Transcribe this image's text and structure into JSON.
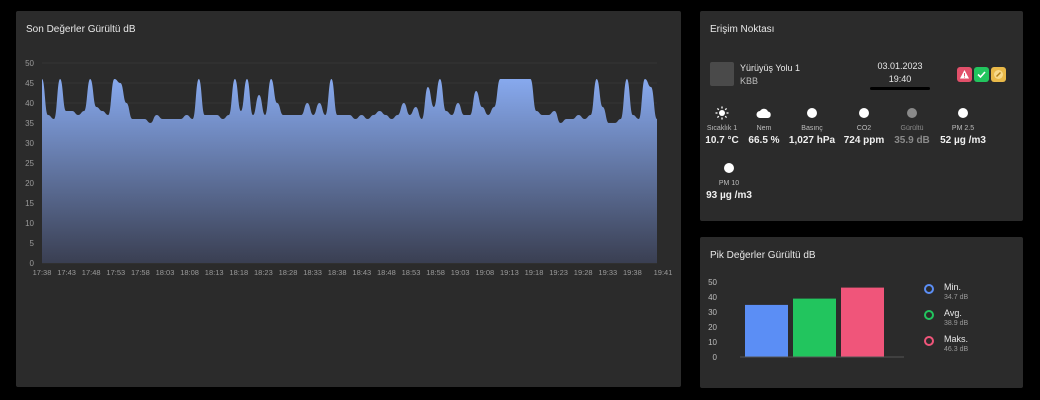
{
  "noise_panel": {
    "title": "Son Değerler Gürültü dB"
  },
  "access_point": {
    "title": "Erişim Noktası",
    "station_name": "Yürüyüş Yolu 1",
    "station_sub": "KBB",
    "date": "03.01.2023",
    "time": "19:40",
    "badges": [
      {
        "icon": "warning-icon",
        "color": "#e2506a"
      },
      {
        "icon": "check-icon",
        "color": "#22c55e"
      },
      {
        "icon": "edit-icon",
        "color": "#e9b949"
      }
    ],
    "metrics": [
      {
        "name": "temperature",
        "icon": "sun-icon",
        "label": "Sıcaklık 1",
        "value": "10.7 °C"
      },
      {
        "name": "humidity",
        "icon": "cloud-icon",
        "label": "Nem",
        "value": "66.5 %"
      },
      {
        "name": "pressure",
        "icon": "dot-icon",
        "label": "Basınç",
        "value": "1,027 hPa"
      },
      {
        "name": "co2",
        "icon": "dot-icon",
        "label": "CO2",
        "value": "724 ppm"
      },
      {
        "name": "noise",
        "icon": "dot-icon",
        "label": "Gürültü",
        "value": "35.9 dB",
        "dim": true
      },
      {
        "name": "pm25",
        "icon": "dot-icon",
        "label": "PM 2.5",
        "value": "52 µg /m3"
      },
      {
        "name": "pm10",
        "icon": "dot-icon",
        "label": "PM 10",
        "value": "93 µg /m3"
      }
    ]
  },
  "peak_panel": {
    "title": "Pik Değerler Gürültü dB",
    "legend": [
      {
        "name": "Min.",
        "value": "34.7 dB",
        "color": "#5b8ef5"
      },
      {
        "name": "Avg.",
        "value": "38.9 dB",
        "color": "#22c55e"
      },
      {
        "name": "Maks.",
        "value": "46.3 dB",
        "color": "#f0557a"
      }
    ]
  },
  "chart_data": [
    {
      "type": "area",
      "title": "Son Değerler Gürültü dB",
      "ylim": [
        0,
        50
      ],
      "yticks": [
        0,
        5,
        10,
        15,
        20,
        25,
        30,
        35,
        40,
        45,
        50
      ],
      "x_labels": [
        "17:38",
        "17:43",
        "17:48",
        "17:53",
        "17:58",
        "18:03",
        "18:08",
        "18:13",
        "18:18",
        "18:23",
        "18:28",
        "18:33",
        "18:38",
        "18:43",
        "18:48",
        "18:53",
        "18:58",
        "19:03",
        "19:08",
        "19:13",
        "19:18",
        "19:23",
        "19:28",
        "19:33",
        "19:38",
        "19:41"
      ],
      "color": "#7a9ee6",
      "values": [
        46,
        37,
        36,
        46,
        38,
        38,
        37,
        38,
        46,
        39,
        38,
        37,
        46,
        45,
        40,
        36,
        36,
        36,
        35,
        37,
        36,
        36,
        36,
        36,
        37,
        36,
        46,
        37,
        37,
        37,
        36,
        37,
        46,
        38,
        46,
        37,
        42,
        37,
        46,
        40,
        37,
        37,
        37,
        37,
        40,
        37,
        40,
        37,
        46,
        37,
        37,
        37,
        36,
        37,
        36,
        37,
        38,
        37,
        36,
        37,
        40,
        37,
        39,
        36,
        44,
        39,
        46,
        38,
        37,
        40,
        37,
        37,
        43,
        39,
        37,
        39,
        46,
        46,
        46,
        46,
        46,
        46,
        38,
        37,
        37,
        38,
        35,
        36,
        36,
        37,
        36,
        37,
        46,
        39,
        35,
        35,
        36,
        46,
        37,
        36,
        46,
        44,
        36
      ]
    },
    {
      "type": "bar",
      "title": "Pik Değerler Gürültü dB",
      "ylim": [
        0,
        50
      ],
      "yticks": [
        0,
        10,
        20,
        30,
        40,
        50
      ],
      "categories": [
        "Min.",
        "Avg.",
        "Maks."
      ],
      "values": [
        34.7,
        38.9,
        46.3
      ],
      "colors": [
        "#5b8ef5",
        "#22c55e",
        "#f0557a"
      ]
    }
  ]
}
